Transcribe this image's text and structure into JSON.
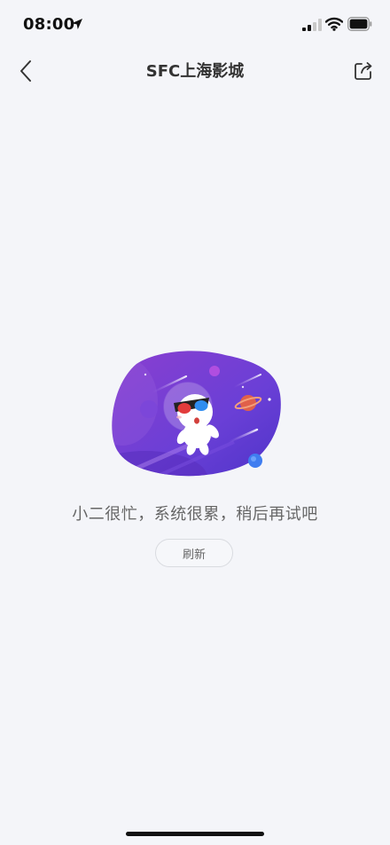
{
  "status_bar": {
    "time": "08:00"
  },
  "header": {
    "title": "SFC上海影城"
  },
  "error_state": {
    "message": "小二很忙，系统很累，稍后再试吧",
    "refresh_label": "刷新"
  },
  "icons": {
    "back": "chevron-left-icon",
    "share": "share-icon",
    "location": "location-arrow-icon",
    "signal": "cellular-signal-icon",
    "wifi": "wifi-icon",
    "battery": "battery-icon"
  },
  "colors": {
    "background": "#f4f5f9",
    "illustration_purple": "#6a3fd6",
    "illustration_violet": "#8a3fd0",
    "text_secondary": "#666666"
  }
}
